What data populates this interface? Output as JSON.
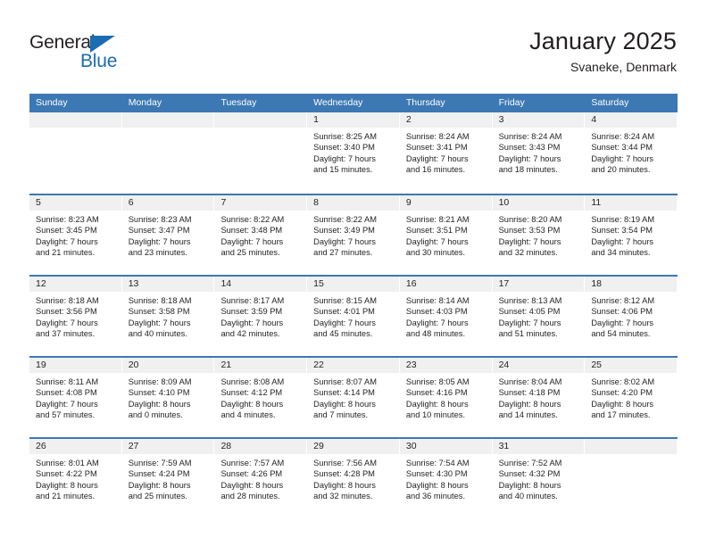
{
  "logo": {
    "word_top": "General",
    "word_bottom": "Blue",
    "triangle_icon": "triangle-icon",
    "brand_color": "#1c6cb4"
  },
  "header": {
    "title": "January 2025",
    "subtitle": "Svaneke, Denmark"
  },
  "calendar": {
    "header_color": "#3c78b4",
    "weekdays": [
      "Sunday",
      "Monday",
      "Tuesday",
      "Wednesday",
      "Thursday",
      "Friday",
      "Saturday"
    ],
    "weeks": [
      [
        {
          "empty": true
        },
        {
          "empty": true
        },
        {
          "empty": true
        },
        {
          "date": "1",
          "sunrise": "Sunrise: 8:25 AM",
          "sunset": "Sunset: 3:40 PM",
          "daylight1": "Daylight: 7 hours",
          "daylight2": "and 15 minutes."
        },
        {
          "date": "2",
          "sunrise": "Sunrise: 8:24 AM",
          "sunset": "Sunset: 3:41 PM",
          "daylight1": "Daylight: 7 hours",
          "daylight2": "and 16 minutes."
        },
        {
          "date": "3",
          "sunrise": "Sunrise: 8:24 AM",
          "sunset": "Sunset: 3:43 PM",
          "daylight1": "Daylight: 7 hours",
          "daylight2": "and 18 minutes."
        },
        {
          "date": "4",
          "sunrise": "Sunrise: 8:24 AM",
          "sunset": "Sunset: 3:44 PM",
          "daylight1": "Daylight: 7 hours",
          "daylight2": "and 20 minutes."
        }
      ],
      [
        {
          "date": "5",
          "sunrise": "Sunrise: 8:23 AM",
          "sunset": "Sunset: 3:45 PM",
          "daylight1": "Daylight: 7 hours",
          "daylight2": "and 21 minutes."
        },
        {
          "date": "6",
          "sunrise": "Sunrise: 8:23 AM",
          "sunset": "Sunset: 3:47 PM",
          "daylight1": "Daylight: 7 hours",
          "daylight2": "and 23 minutes."
        },
        {
          "date": "7",
          "sunrise": "Sunrise: 8:22 AM",
          "sunset": "Sunset: 3:48 PM",
          "daylight1": "Daylight: 7 hours",
          "daylight2": "and 25 minutes."
        },
        {
          "date": "8",
          "sunrise": "Sunrise: 8:22 AM",
          "sunset": "Sunset: 3:49 PM",
          "daylight1": "Daylight: 7 hours",
          "daylight2": "and 27 minutes."
        },
        {
          "date": "9",
          "sunrise": "Sunrise: 8:21 AM",
          "sunset": "Sunset: 3:51 PM",
          "daylight1": "Daylight: 7 hours",
          "daylight2": "and 30 minutes."
        },
        {
          "date": "10",
          "sunrise": "Sunrise: 8:20 AM",
          "sunset": "Sunset: 3:53 PM",
          "daylight1": "Daylight: 7 hours",
          "daylight2": "and 32 minutes."
        },
        {
          "date": "11",
          "sunrise": "Sunrise: 8:19 AM",
          "sunset": "Sunset: 3:54 PM",
          "daylight1": "Daylight: 7 hours",
          "daylight2": "and 34 minutes."
        }
      ],
      [
        {
          "date": "12",
          "sunrise": "Sunrise: 8:18 AM",
          "sunset": "Sunset: 3:56 PM",
          "daylight1": "Daylight: 7 hours",
          "daylight2": "and 37 minutes."
        },
        {
          "date": "13",
          "sunrise": "Sunrise: 8:18 AM",
          "sunset": "Sunset: 3:58 PM",
          "daylight1": "Daylight: 7 hours",
          "daylight2": "and 40 minutes."
        },
        {
          "date": "14",
          "sunrise": "Sunrise: 8:17 AM",
          "sunset": "Sunset: 3:59 PM",
          "daylight1": "Daylight: 7 hours",
          "daylight2": "and 42 minutes."
        },
        {
          "date": "15",
          "sunrise": "Sunrise: 8:15 AM",
          "sunset": "Sunset: 4:01 PM",
          "daylight1": "Daylight: 7 hours",
          "daylight2": "and 45 minutes."
        },
        {
          "date": "16",
          "sunrise": "Sunrise: 8:14 AM",
          "sunset": "Sunset: 4:03 PM",
          "daylight1": "Daylight: 7 hours",
          "daylight2": "and 48 minutes."
        },
        {
          "date": "17",
          "sunrise": "Sunrise: 8:13 AM",
          "sunset": "Sunset: 4:05 PM",
          "daylight1": "Daylight: 7 hours",
          "daylight2": "and 51 minutes."
        },
        {
          "date": "18",
          "sunrise": "Sunrise: 8:12 AM",
          "sunset": "Sunset: 4:06 PM",
          "daylight1": "Daylight: 7 hours",
          "daylight2": "and 54 minutes."
        }
      ],
      [
        {
          "date": "19",
          "sunrise": "Sunrise: 8:11 AM",
          "sunset": "Sunset: 4:08 PM",
          "daylight1": "Daylight: 7 hours",
          "daylight2": "and 57 minutes."
        },
        {
          "date": "20",
          "sunrise": "Sunrise: 8:09 AM",
          "sunset": "Sunset: 4:10 PM",
          "daylight1": "Daylight: 8 hours",
          "daylight2": "and 0 minutes."
        },
        {
          "date": "21",
          "sunrise": "Sunrise: 8:08 AM",
          "sunset": "Sunset: 4:12 PM",
          "daylight1": "Daylight: 8 hours",
          "daylight2": "and 4 minutes."
        },
        {
          "date": "22",
          "sunrise": "Sunrise: 8:07 AM",
          "sunset": "Sunset: 4:14 PM",
          "daylight1": "Daylight: 8 hours",
          "daylight2": "and 7 minutes."
        },
        {
          "date": "23",
          "sunrise": "Sunrise: 8:05 AM",
          "sunset": "Sunset: 4:16 PM",
          "daylight1": "Daylight: 8 hours",
          "daylight2": "and 10 minutes."
        },
        {
          "date": "24",
          "sunrise": "Sunrise: 8:04 AM",
          "sunset": "Sunset: 4:18 PM",
          "daylight1": "Daylight: 8 hours",
          "daylight2": "and 14 minutes."
        },
        {
          "date": "25",
          "sunrise": "Sunrise: 8:02 AM",
          "sunset": "Sunset: 4:20 PM",
          "daylight1": "Daylight: 8 hours",
          "daylight2": "and 17 minutes."
        }
      ],
      [
        {
          "date": "26",
          "sunrise": "Sunrise: 8:01 AM",
          "sunset": "Sunset: 4:22 PM",
          "daylight1": "Daylight: 8 hours",
          "daylight2": "and 21 minutes."
        },
        {
          "date": "27",
          "sunrise": "Sunrise: 7:59 AM",
          "sunset": "Sunset: 4:24 PM",
          "daylight1": "Daylight: 8 hours",
          "daylight2": "and 25 minutes."
        },
        {
          "date": "28",
          "sunrise": "Sunrise: 7:57 AM",
          "sunset": "Sunset: 4:26 PM",
          "daylight1": "Daylight: 8 hours",
          "daylight2": "and 28 minutes."
        },
        {
          "date": "29",
          "sunrise": "Sunrise: 7:56 AM",
          "sunset": "Sunset: 4:28 PM",
          "daylight1": "Daylight: 8 hours",
          "daylight2": "and 32 minutes."
        },
        {
          "date": "30",
          "sunrise": "Sunrise: 7:54 AM",
          "sunset": "Sunset: 4:30 PM",
          "daylight1": "Daylight: 8 hours",
          "daylight2": "and 36 minutes."
        },
        {
          "date": "31",
          "sunrise": "Sunrise: 7:52 AM",
          "sunset": "Sunset: 4:32 PM",
          "daylight1": "Daylight: 8 hours",
          "daylight2": "and 40 minutes."
        },
        {
          "empty": true
        }
      ]
    ]
  }
}
